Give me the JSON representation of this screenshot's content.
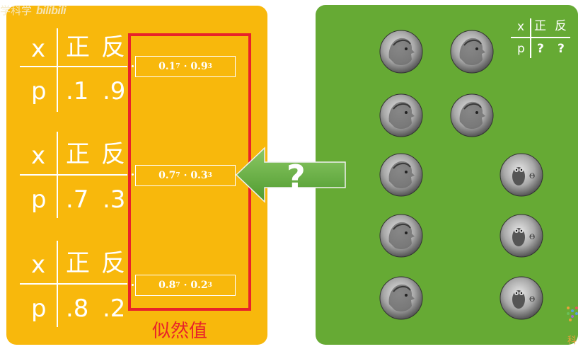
{
  "watermark": {
    "text": "学科学",
    "logo": "bilibili"
  },
  "left_tables": [
    {
      "x_label": "x",
      "heads": "正",
      "tails": "反",
      "p_label": "p",
      "p_heads": ".1",
      "p_tails": ".9"
    },
    {
      "x_label": "x",
      "heads": "正",
      "tails": "反",
      "p_label": "p",
      "p_heads": ".7",
      "p_tails": ".3"
    },
    {
      "x_label": "x",
      "heads": "正",
      "tails": "反",
      "p_label": "p",
      "p_heads": ".8",
      "p_tails": ".2"
    }
  ],
  "formulas": [
    {
      "base1": "0.1",
      "exp1": "7",
      "dot": "·",
      "base2": "0.9",
      "exp2": "3"
    },
    {
      "base1": "0.7",
      "exp1": "7",
      "dot": "·",
      "base2": "0.3",
      "exp2": "3"
    },
    {
      "base1": "0.8",
      "exp1": "7",
      "dot": "·",
      "base2": "0.2",
      "exp2": "3"
    }
  ],
  "likelihood_label": "似然值",
  "arrow_label": "?",
  "mini_table": {
    "x_label": "x",
    "heads": "正",
    "tails": "反",
    "p_label": "p",
    "p_heads": "?",
    "p_tails": "?"
  },
  "coins": {
    "heads_count": 7,
    "tails_count": 3
  },
  "corner_logo_text": "科",
  "colors": {
    "left_panel": "#f8b80c",
    "right_panel": "#66aa34",
    "frame": "#e8222a",
    "arrow": "#5aa83a"
  }
}
